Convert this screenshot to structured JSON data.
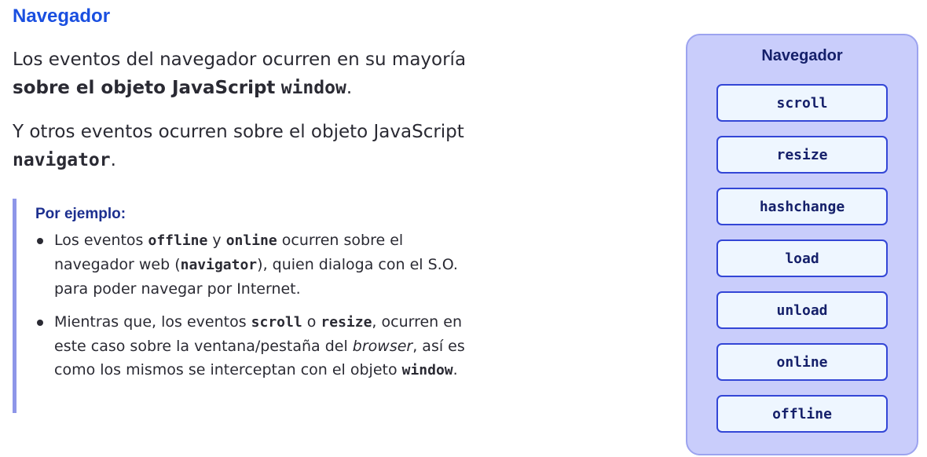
{
  "heading": "Navegador",
  "para1": {
    "text1": "Los eventos del navegador ocurren en su mayoría",
    "bold": "sobre el objeto JavaScript",
    "code": "window",
    "end": "."
  },
  "para2": {
    "text1": "Y otros eventos ocurren sobre el objeto JavaScript",
    "code": "navigator",
    "end": "."
  },
  "callout": {
    "title": "Por ejemplo:",
    "item1": {
      "t1": "Los eventos ",
      "c1": "offline",
      "t2": " y ",
      "c2": "online",
      "t3": " ocurren sobre el navegador web (",
      "c3": "navigator",
      "t4": "), quien dialoga con el S.O. para poder navegar por Internet."
    },
    "item2": {
      "t1": "Mientras que, los eventos ",
      "c1": "scroll",
      "t2": " o ",
      "c2": "resize",
      "t3": ", ocurren en este caso sobre la ventana/pestaña del ",
      "em": "browser",
      "t4": ", así es como los mismos se interceptan con el objeto ",
      "c3": "window",
      "t5": "."
    }
  },
  "panel": {
    "title": "Navegador",
    "events": [
      "scroll",
      "resize",
      "hashchange",
      "load",
      "unload",
      "online",
      "offline"
    ]
  }
}
